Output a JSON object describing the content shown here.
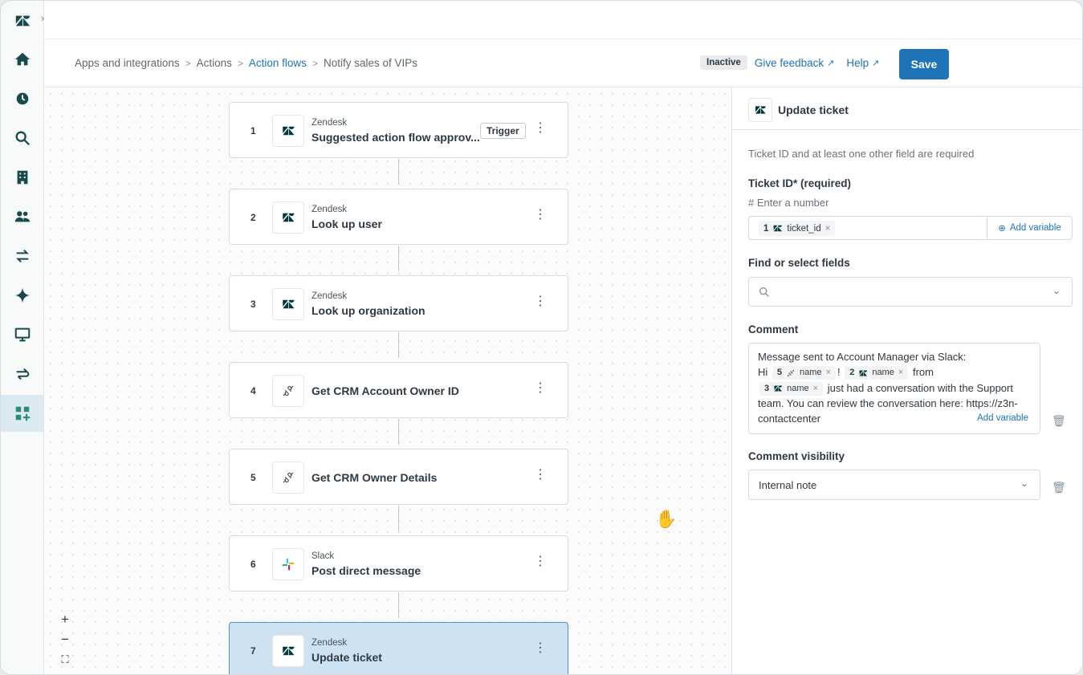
{
  "nav": {
    "items": [
      "zendesk-logo",
      "home",
      "views",
      "search",
      "organizations",
      "customers",
      "actions",
      "ai-agents",
      "workspace",
      "integrations",
      "apps"
    ]
  },
  "breadcrumb": {
    "items": [
      "Apps and integrations",
      "Actions",
      "Action flows",
      "Notify sales of VIPs"
    ],
    "separator": ">"
  },
  "header": {
    "status": "Inactive",
    "feedback": "Give feedback",
    "help": "Help",
    "save": "Save"
  },
  "steps": [
    {
      "num": "1",
      "app": "Zendesk",
      "title": "Suggested action flow approv...",
      "tag": "Trigger",
      "icon": "zendesk-icon"
    },
    {
      "num": "2",
      "app": "Zendesk",
      "title": "Look up user",
      "icon": "zendesk-icon"
    },
    {
      "num": "3",
      "app": "Zendesk",
      "title": "Look up organization",
      "icon": "zendesk-icon"
    },
    {
      "num": "4",
      "app": "",
      "title": "Get CRM Account Owner ID",
      "icon": "plug-icon"
    },
    {
      "num": "5",
      "app": "",
      "title": "Get CRM Owner Details",
      "icon": "plug-icon"
    },
    {
      "num": "6",
      "app": "Slack",
      "title": "Post direct message",
      "icon": "slack-icon"
    },
    {
      "num": "7",
      "app": "Zendesk",
      "title": "Update ticket",
      "icon": "zendesk-icon"
    }
  ],
  "zoom": {
    "in": "+",
    "out": "−",
    "fit": "⛶"
  },
  "panel": {
    "title": "Update ticket",
    "hint": "Ticket ID and at least one other field are required",
    "ticket_id_label": "Ticket ID* (required)",
    "ticket_id_sub": "# Enter a number",
    "ticket_pill": {
      "num": "1",
      "name": "ticket_id"
    },
    "add_variable": "Add variable",
    "find_label": "Find or select fields",
    "comment_label": "Comment",
    "comment": {
      "line1": "Message sent to Account Manager via Slack:",
      "hi": "Hi",
      "pill_a": {
        "num": "5",
        "name": "name"
      },
      "bang": "!",
      "pill_b": {
        "num": "2",
        "name": "name"
      },
      "from": "from",
      "pill_c": {
        "num": "3",
        "name": "name"
      },
      "rest": "just had a conversation with the Support team. You can review the conversation here: https://z3n-contactcenter",
      "add": "Add variable"
    },
    "visibility_label": "Comment visibility",
    "visibility_value": "Internal note"
  }
}
